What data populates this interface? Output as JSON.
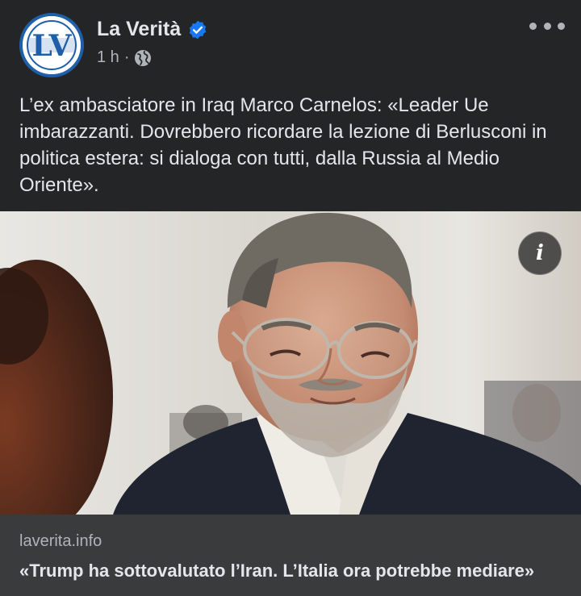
{
  "post": {
    "page_name": "La Verità",
    "avatar_text": "LV",
    "time": "1 h",
    "separator": "·",
    "privacy_icon": "globe-icon",
    "verified_icon": "verified-badge-icon",
    "menu_icon": "more-horizontal-icon",
    "text": "L’ex ambasciatore in Iraq Marco Carnelos: «Leader Ue imbarazzanti. Dovrebbero ricordare la lezione di Berlusconi in politica estera: si dialoga con tutti, dalla Russia al Medio Oriente»."
  },
  "photo": {
    "info_label": "i"
  },
  "link_preview": {
    "domain": "laverita.info",
    "title": "«Trump ha sottovalutato l’Iran. L’Italia ora potrebbe mediare»"
  },
  "colors": {
    "background": "#242526",
    "text_primary": "#e4e6eb",
    "text_secondary": "#b0b3b8",
    "link_background": "#3a3b3c",
    "verified_blue": "#1877f2",
    "avatar_blue": "#1f5faa"
  }
}
